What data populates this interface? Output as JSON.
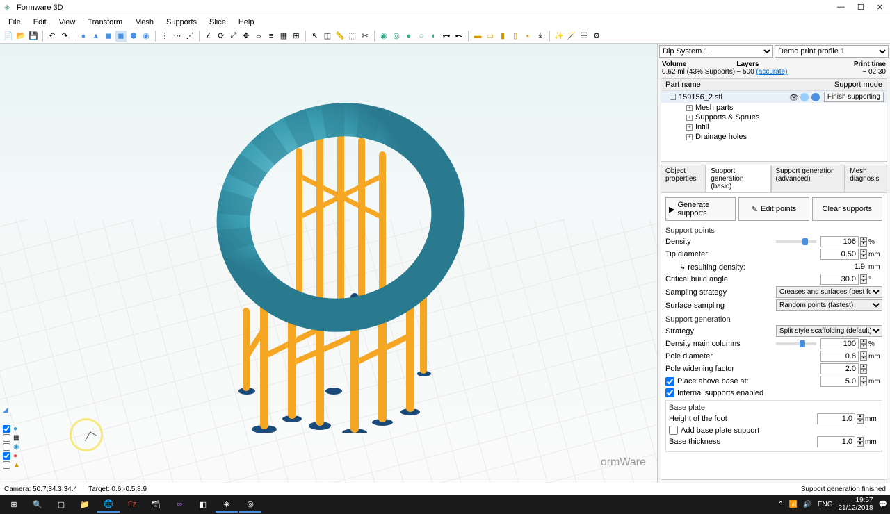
{
  "title": "Formware 3D",
  "menu": [
    "File",
    "Edit",
    "View",
    "Transform",
    "Mesh",
    "Supports",
    "Slice",
    "Help"
  ],
  "selects": {
    "system": "Dlp System 1",
    "profile": "Demo print profile 1"
  },
  "stats": {
    "volume_label": "Volume",
    "volume_val": "0.62 ml (43% Supports)",
    "layers_label": "Layers",
    "layers_val": "~ 500",
    "layers_link": "(accurate)",
    "time_label": "Print time",
    "time_val": "~ 02:30"
  },
  "tree": {
    "header_name": "Part name",
    "header_mode": "Support mode",
    "root": "159156_2.stl",
    "finish": "Finish supporting",
    "children": [
      "Mesh parts",
      "Supports & Sprues",
      "Infill",
      "Drainage holes"
    ]
  },
  "tabs": [
    "Object properties",
    "Support generation (basic)",
    "Support generation (advanced)",
    "Mesh diagnosis"
  ],
  "buttons": {
    "gen": "Generate supports",
    "edit": "Edit points",
    "clear": "Clear supports"
  },
  "sec_points": "Support points",
  "density": {
    "label": "Density",
    "val": "106",
    "unit": "%"
  },
  "tip": {
    "label": "Tip diameter",
    "val": "0.50",
    "unit": "mm"
  },
  "resulting": {
    "label": "↳ resulting density:",
    "val": "1.9",
    "unit": "mm"
  },
  "angle": {
    "label": "Critical build angle",
    "val": "30.0",
    "unit": "°"
  },
  "sampling": {
    "label": "Sampling strategy",
    "val": "Creases and surfaces (best for normal model)"
  },
  "surface": {
    "label": "Surface sampling",
    "val": "Random points (fastest)"
  },
  "sec_gen": "Support generation",
  "strategy": {
    "label": "Strategy",
    "val": "Split style scaffolding (default)"
  },
  "dens_main": {
    "label": "Density main columns",
    "val": "100",
    "unit": "%"
  },
  "pole": {
    "label": "Pole diameter",
    "val": "0.8",
    "unit": "mm"
  },
  "widen": {
    "label": "Pole widening factor",
    "val": "2.0"
  },
  "above": {
    "label": "Place above base at:",
    "val": "5.0",
    "unit": "mm"
  },
  "internal": {
    "label": "Internal supports enabled"
  },
  "sec_base": "Base plate",
  "foot": {
    "label": "Height of the foot",
    "val": "1.0",
    "unit": "mm"
  },
  "addbase": {
    "label": "Add base plate support"
  },
  "thickness": {
    "label": "Base thickness",
    "val": "1.0",
    "unit": "mm"
  },
  "watermark": "ormWare",
  "status": {
    "camera": "Camera:  50.7;34.3;34.4",
    "target": "Target:  0.6;-0.5;8.9",
    "right": "Support generation finished"
  },
  "tray": {
    "lang": "ENG",
    "time": "19:57",
    "date": "21/12/2018"
  }
}
